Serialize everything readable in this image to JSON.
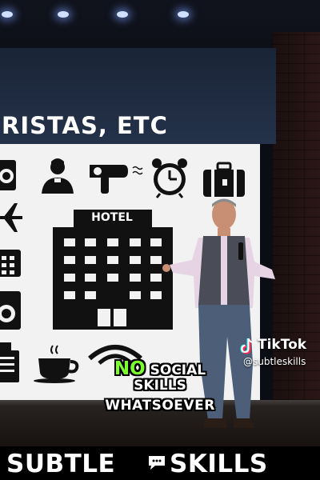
{
  "slide": {
    "title_partial": "RISTAS, ETC",
    "hotel_sign": "HOTEL",
    "icons": [
      "radio-icon",
      "receptionist-icon",
      "hair-dryer-icon",
      "alarm-clock-icon",
      "suitcase-icon",
      "airplane-icon",
      "hotel-building-icon",
      "calculator-icon",
      "washing-machine-icon",
      "cash-register-icon",
      "coffee-cup-icon",
      "wifi-icon"
    ]
  },
  "captions": {
    "highlight": "NO",
    "line1_rest": " SOCIAL",
    "line2": "SKILLS",
    "line3": "WHATSOEVER"
  },
  "watermark": {
    "brand": "TikTok",
    "handle": "@subtleskills"
  },
  "banner": {
    "left_word": "SUBTLE",
    "right_word": "SKILLS",
    "separator_icon": "speech-bubble-icon"
  },
  "colors": {
    "caption_highlight": "#7cff2e",
    "slide_background": "#f2f2f2",
    "banner_background": "#000000"
  }
}
